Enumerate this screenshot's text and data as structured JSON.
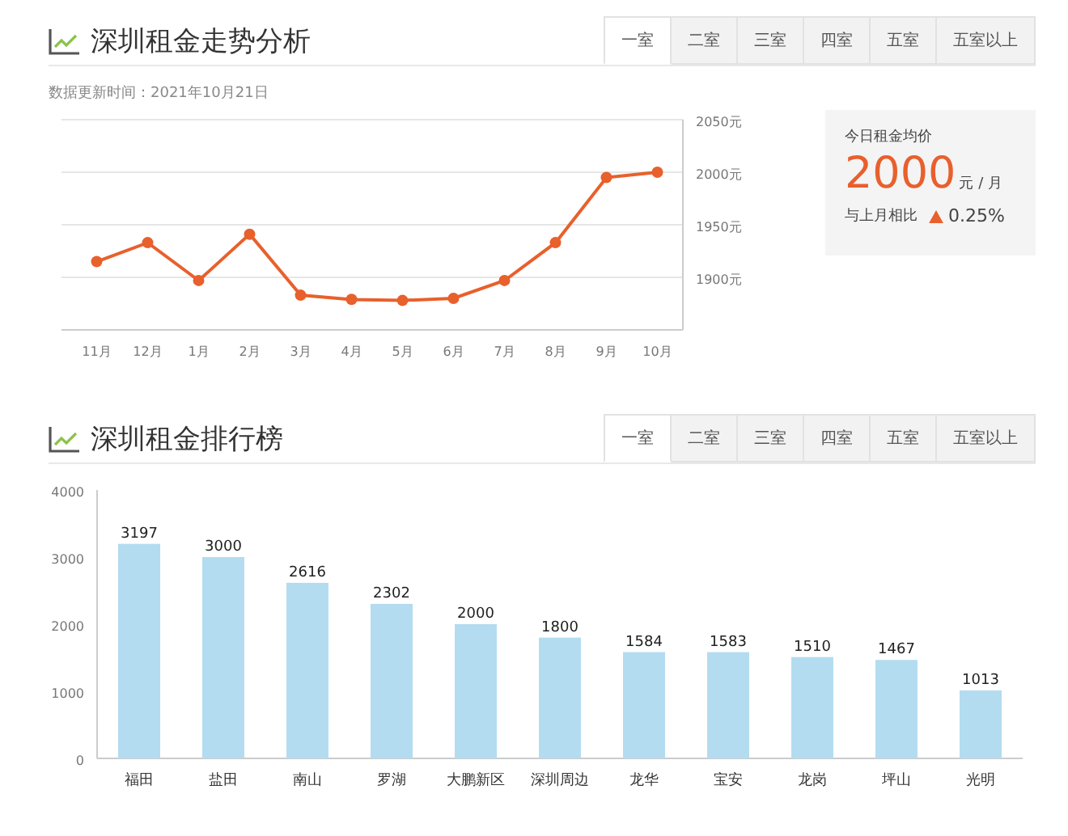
{
  "sections": [
    {
      "title": "深圳租金走势分析",
      "tabs": [
        {
          "label": "一室",
          "selected": true
        },
        {
          "label": "二室",
          "selected": false
        },
        {
          "label": "三室",
          "selected": false
        },
        {
          "label": "四室",
          "selected": false
        },
        {
          "label": "五室",
          "selected": false
        },
        {
          "label": "五室以上",
          "selected": false
        }
      ],
      "update_time": "数据更新时间：2021年10月21日",
      "chart_data": {
        "type": "line",
        "categories": [
          "11月",
          "12月",
          "1月",
          "2月",
          "3月",
          "4月",
          "5月",
          "6月",
          "7月",
          "8月",
          "9月",
          "10月"
        ],
        "series": [
          {
            "color": "#e8602c",
            "marker": "circle",
            "values": [
              1915,
              1933,
              1897,
              1941,
              1883,
              1879,
              1878,
              1880,
              1897,
              1933,
              1995,
              2000
            ]
          }
        ],
        "ylim": [
          1850,
          2050
        ],
        "grid": true,
        "yticks": [
          {
            "value": 1900,
            "label": "1900元"
          },
          {
            "value": 1950,
            "label": "1950元"
          },
          {
            "value": 2000,
            "label": "2000元"
          },
          {
            "value": 2050,
            "label": "2050元"
          }
        ]
      },
      "summary": {
        "label": "今日租金均价",
        "price": "2000",
        "unit": "元 / 月",
        "compare_label": "与上月相比",
        "change": "0.25%",
        "rising": true
      }
    },
    {
      "title": "深圳租金排行榜",
      "tabs": [
        {
          "label": "一室",
          "selected": true
        },
        {
          "label": "二室",
          "selected": false
        },
        {
          "label": "三室",
          "selected": false
        },
        {
          "label": "四室",
          "selected": false
        },
        {
          "label": "五室",
          "selected": false
        },
        {
          "label": "五室以上",
          "selected": false
        }
      ],
      "chart_data": {
        "type": "bar",
        "categories": [
          "福田",
          "盐田",
          "南山",
          "罗湖",
          "大鹏新区",
          "深圳周边",
          "龙华",
          "宝安",
          "龙岗",
          "坪山",
          "光明"
        ],
        "series": [
          {
            "color": "#b3dcf0",
            "values": [
              3197,
              3000,
              2616,
              2302,
              2000,
              1800,
              1584,
              1583,
              1510,
              1467,
              1013
            ]
          }
        ],
        "ylim": [
          0,
          4000
        ],
        "yticks": [
          0,
          1000,
          2000,
          3000,
          4000
        ],
        "data_labels": true
      }
    }
  ]
}
